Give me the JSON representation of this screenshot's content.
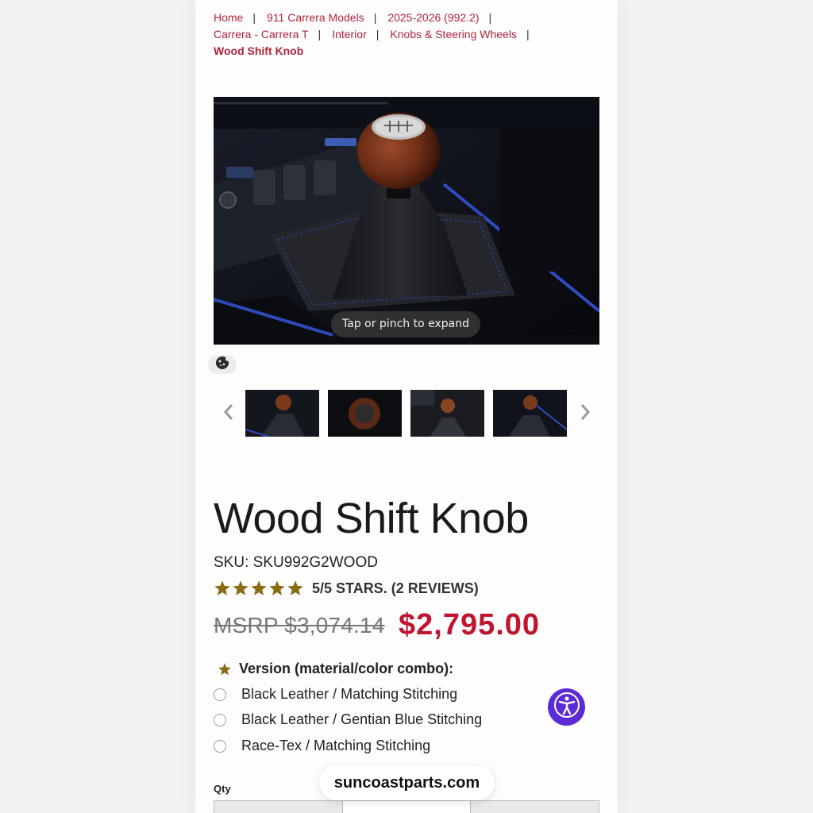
{
  "breadcrumb": {
    "items": [
      "Home",
      "911 Carrera Models",
      "2025-2026 (992.2)",
      "Carrera - Carrera T",
      "Interior",
      "Knobs & Steering Wheels"
    ],
    "current": "Wood Shift Knob",
    "separator": "|"
  },
  "gallery": {
    "expand_hint": "Tap or pinch to expand",
    "thumbnail_count": 4
  },
  "product": {
    "title": "Wood Shift Knob",
    "sku": "SKU: SKU992G2WOOD",
    "rating": {
      "value": 5,
      "max": 5,
      "label": "5/5 STARS. (2 REVIEWS)"
    },
    "msrp": "MSRP $3,074.14",
    "price": "$2,795.00"
  },
  "options": {
    "label": "Version (material/color combo):",
    "items": [
      "Black Leather / Matching Stitching",
      "Black Leather / Gentian Blue Stitching",
      "Race-Tex / Matching Stitching"
    ]
  },
  "quantity": {
    "label": "Qty"
  },
  "browser": {
    "url": "suncoastparts.com"
  },
  "icons": {
    "gallery_prev": "chevron-left-icon",
    "gallery_next": "chevron-right-icon",
    "cookie": "cookie-icon",
    "required": "star-icon",
    "accessibility": "accessibility-icon"
  },
  "colors": {
    "accent": "#b0243a",
    "price": "#c0152f",
    "star": "#8a6a12",
    "accessibility": "#5b2bd6"
  }
}
